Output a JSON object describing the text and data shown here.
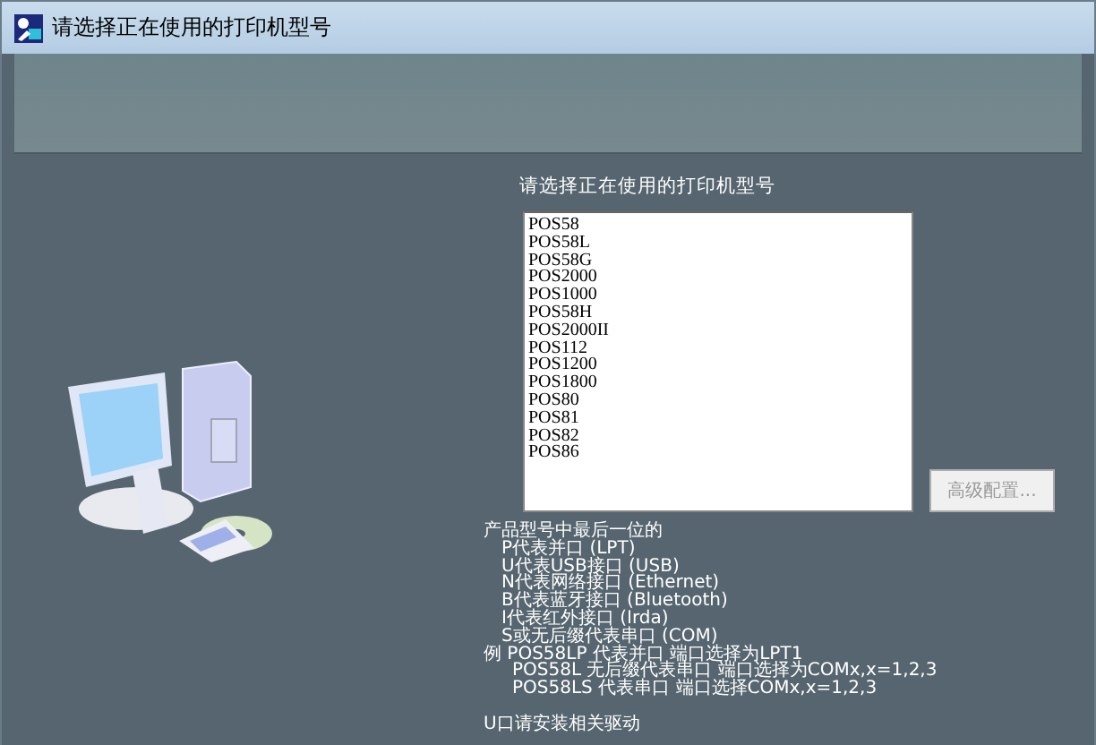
{
  "window": {
    "title": "请选择正在使用的打印机型号"
  },
  "prompt": "请选择正在使用的打印机型号",
  "printers": [
    {
      "label": "POS58",
      "selected": false
    },
    {
      "label": "POS58L",
      "selected": false
    },
    {
      "label": "POS58G",
      "selected": false
    },
    {
      "label": "POS2000",
      "selected": false
    },
    {
      "label": "POS1000",
      "selected": false
    },
    {
      "label": "POS58H",
      "selected": false
    },
    {
      "label": "POS2000II",
      "selected": false
    },
    {
      "label": "POS112",
      "selected": false
    },
    {
      "label": "POS1200",
      "selected": false
    },
    {
      "label": "POS1800",
      "selected": false
    },
    {
      "label": "POS80",
      "selected": false
    },
    {
      "label": "POS81",
      "selected": false
    },
    {
      "label": "POS82",
      "selected": false
    },
    {
      "label": "POS86",
      "selected": false
    }
  ],
  "advanced_button": {
    "label": "高级配置...",
    "disabled": true
  },
  "help": {
    "heading": "产品型号中最后一位的",
    "items": [
      "P代表并口 (LPT)",
      "U代表USB接口 (USB)",
      "N代表网络接口 (Ethernet)",
      "B代表蓝牙接口 (Bluetooth)",
      "I代表红外接口 (Irda)",
      "S或无后缀代表串口 (COM)"
    ],
    "example": "例 POS58LP 代表并口 端口选择为LPT1",
    "example_children": [
      "POS58L 无后缀代表串口 端口选择为COMx,x=1,2,3",
      "POS58LS 代表串口 端口选择COMx,x=1,2,3"
    ],
    "note": "U口请安装相关驱动"
  }
}
